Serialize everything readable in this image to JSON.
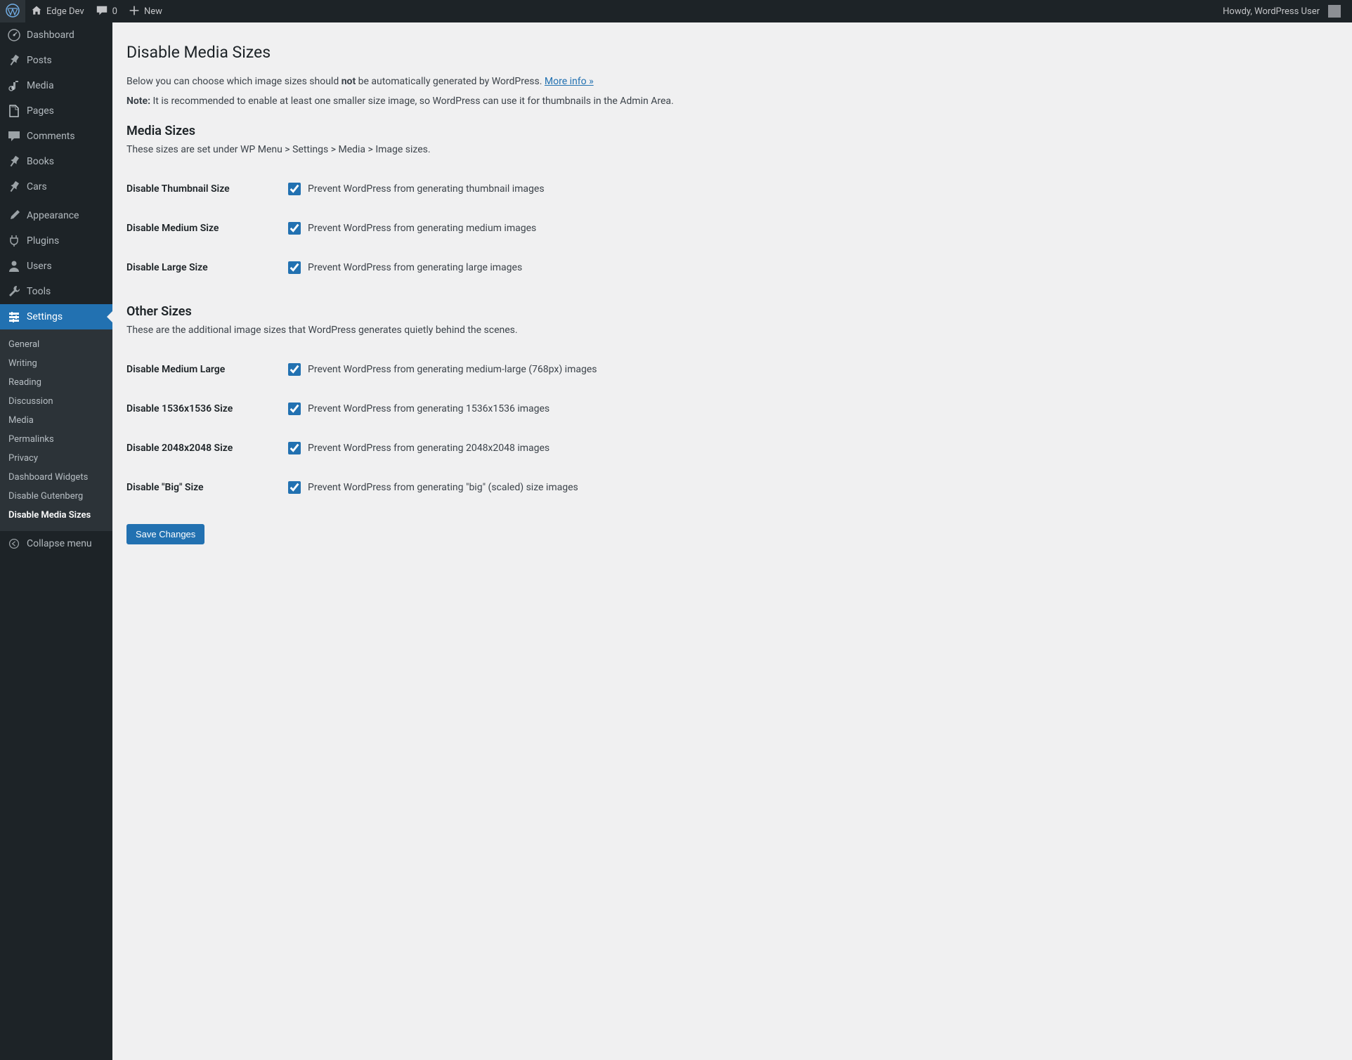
{
  "adminbar": {
    "site_name": "Edge Dev",
    "comments_count": "0",
    "new_label": "New",
    "howdy": "Howdy, WordPress User"
  },
  "sidebar": {
    "items": [
      {
        "icon": "dashboard",
        "label": "Dashboard"
      },
      {
        "icon": "pin",
        "label": "Posts"
      },
      {
        "icon": "media",
        "label": "Media"
      },
      {
        "icon": "page",
        "label": "Pages"
      },
      {
        "icon": "comment",
        "label": "Comments"
      },
      {
        "icon": "pin",
        "label": "Books"
      },
      {
        "icon": "pin",
        "label": "Cars"
      },
      {
        "separator": true
      },
      {
        "icon": "brush",
        "label": "Appearance"
      },
      {
        "icon": "plug",
        "label": "Plugins"
      },
      {
        "icon": "user",
        "label": "Users"
      },
      {
        "icon": "wrench",
        "label": "Tools"
      },
      {
        "icon": "sliders",
        "label": "Settings",
        "current": true
      }
    ],
    "submenu": [
      {
        "label": "General"
      },
      {
        "label": "Writing"
      },
      {
        "label": "Reading"
      },
      {
        "label": "Discussion"
      },
      {
        "label": "Media"
      },
      {
        "label": "Permalinks"
      },
      {
        "label": "Privacy"
      },
      {
        "label": "Dashboard Widgets"
      },
      {
        "label": "Disable Gutenberg"
      },
      {
        "label": "Disable Media Sizes",
        "current": true
      }
    ],
    "collapse_label": "Collapse menu"
  },
  "page": {
    "title": "Disable Media Sizes",
    "intro_before": "Below you can choose which image sizes should ",
    "intro_bold": "not",
    "intro_after": " be automatically generated by WordPress. ",
    "more_info": "More info »",
    "note_label": "Note:",
    "note_text": " It is recommended to enable at least one smaller size image, so WordPress can use it for thumbnails in the Admin Area.",
    "section_media": {
      "heading": "Media Sizes",
      "desc": "These sizes are set under WP Menu > Settings > Media > Image sizes.",
      "rows": [
        {
          "label": "Disable Thumbnail Size",
          "checkbox_label": "Prevent WordPress from generating thumbnail images",
          "checked": true
        },
        {
          "label": "Disable Medium Size",
          "checkbox_label": "Prevent WordPress from generating medium images",
          "checked": true
        },
        {
          "label": "Disable Large Size",
          "checkbox_label": "Prevent WordPress from generating large images",
          "checked": true
        }
      ]
    },
    "section_other": {
      "heading": "Other Sizes",
      "desc": "These are the additional image sizes that WordPress generates quietly behind the scenes.",
      "rows": [
        {
          "label": "Disable Medium Large",
          "checkbox_label": "Prevent WordPress from generating medium-large (768px) images",
          "checked": true
        },
        {
          "label": "Disable 1536x1536 Size",
          "checkbox_label": "Prevent WordPress from generating 1536x1536 images",
          "checked": true
        },
        {
          "label": "Disable 2048x2048 Size",
          "checkbox_label": "Prevent WordPress from generating 2048x2048 images",
          "checked": true
        },
        {
          "label": "Disable \"Big\" Size",
          "checkbox_label": "Prevent WordPress from generating \"big\" (scaled) size images",
          "checked": true
        }
      ]
    },
    "save_label": "Save Changes"
  },
  "icons": {
    "wordpress": "⚙",
    "home": "⌂",
    "comment": "💬",
    "plus": "+",
    "dashboard": "◷",
    "pin": "📌",
    "media": "🎵",
    "page": "📄",
    "brush": "🖌",
    "plug": "🔌",
    "user": "👤",
    "wrench": "🔧",
    "sliders": "⚙",
    "collapse": "◀"
  }
}
